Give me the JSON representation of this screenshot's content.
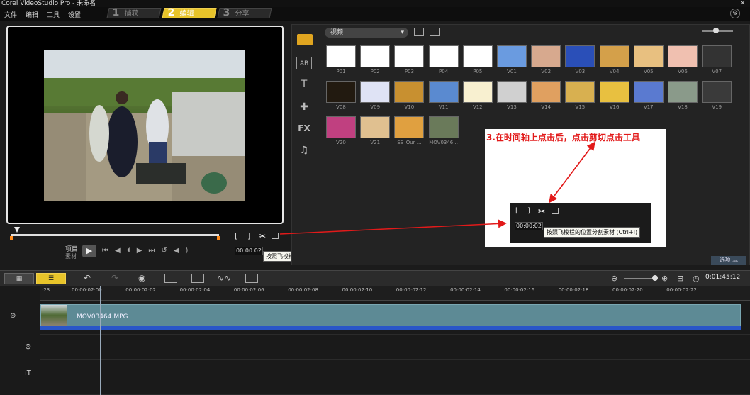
{
  "window": {
    "title": "Corel VideoStudio Pro - 未命名"
  },
  "menu": [
    "文件",
    "编辑",
    "工具",
    "设置"
  ],
  "steps": [
    {
      "num": "1",
      "label": "捕获"
    },
    {
      "num": "2",
      "label": "编辑"
    },
    {
      "num": "3",
      "label": "分享"
    }
  ],
  "preview": {
    "project_label": "项目",
    "clip_label": "素材",
    "timecode": "00:00:02",
    "split_tooltip": "按照飞梭栏的位置分割素材 (Ctrl+I)"
  },
  "library": {
    "category": "视频",
    "thumbs": [
      [
        "P01",
        "P02",
        "P03",
        "P04",
        "P05",
        "V01",
        "V02",
        "V03",
        "V04",
        "V05",
        "V06",
        "V07"
      ],
      [
        "V08",
        "V09",
        "V10",
        "V11",
        "V12",
        "V13",
        "V14",
        "V15",
        "V16",
        "V17",
        "V18",
        "V19"
      ],
      [
        "V20",
        "V21",
        "SS_Our ...",
        "MOV0346..."
      ]
    ],
    "options_label": "选项"
  },
  "annotation": {
    "text": "3.在时间轴上点击后，点击剪切点击工具",
    "timecode": "00:00:02",
    "tooltip": "按照飞梭栏的位置分割素材 (Ctrl+I)"
  },
  "timeline": {
    "total_time": "0:01:45:12",
    "ruler": [
      "00:00:02:00",
      "00:00:02:02",
      "00:00:02:04",
      "00:00:02:06",
      "00:00:02:08",
      "00:00:02:10",
      "00:00:02:12",
      "00:00:02:14",
      "00:00:02:16",
      "00:00:02:18",
      "00:00:02:20",
      "00:00:02:22"
    ],
    "ruler_start": ":23",
    "clip_name": "MOV03464.MPG"
  }
}
